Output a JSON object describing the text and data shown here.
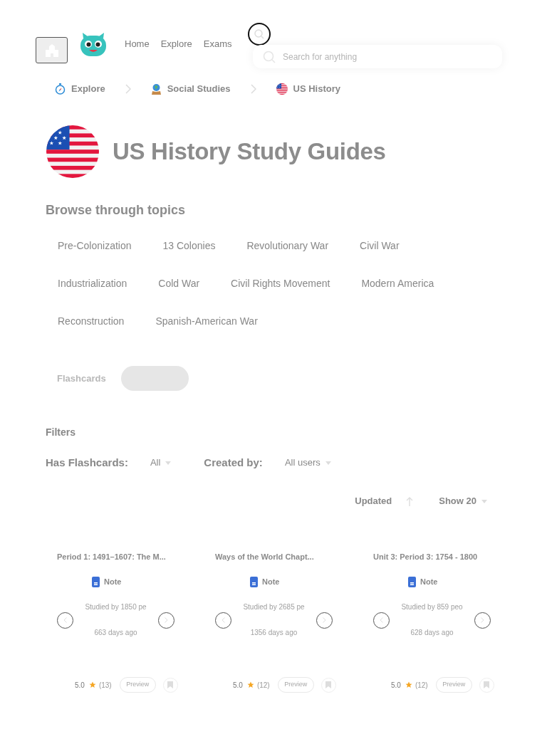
{
  "header": {
    "nav": [
      {
        "label": "Home"
      },
      {
        "label": "Explore"
      },
      {
        "label": "Exams"
      }
    ],
    "search": {
      "placeholder": "Search for anything"
    }
  },
  "breadcrumb": [
    {
      "label": "Explore",
      "kind": "compass"
    },
    {
      "label": "Social Studies",
      "kind": "globe"
    },
    {
      "label": "US History",
      "kind": "flag"
    }
  ],
  "page": {
    "title": "US History Study Guides"
  },
  "topics": {
    "heading": "Browse through topics",
    "items": [
      "Pre-Colonization",
      "13 Colonies",
      "Revolutionary War",
      "Civil War",
      "Industrialization",
      "Cold War",
      "Civil Rights Movement",
      "Modern America",
      "Reconstruction",
      "Spanish-American War"
    ]
  },
  "tabs": [
    {
      "label": "Flashcards",
      "selected": false
    },
    {
      "selected": true
    }
  ],
  "filters": {
    "heading": "Filters",
    "fields": [
      {
        "label": "Has Flashcards:",
        "value": "All"
      },
      {
        "label": "Created by:",
        "value": "All users"
      }
    ]
  },
  "sort": {
    "label": "Updated",
    "page_size": "Show 20"
  },
  "cards": [
    {
      "title": "Period 1: 1491–1607: The M...",
      "type": "Note",
      "studied": "Studied by 1850 pe",
      "age": "663 days ago",
      "rating": "5.0",
      "count": "(13)",
      "action": "Preview"
    },
    {
      "title": "Ways of the World Chapt...",
      "type": "Note",
      "studied": "Studied by 2685 pe",
      "age": "1356 days ago",
      "rating": "5.0",
      "count": "(12)",
      "action": "Preview"
    },
    {
      "title": "Unit 3: Period 3: 1754 - 1800",
      "type": "Note",
      "studied": "Studied by 859 peo",
      "age": "628 days ago",
      "rating": "5.0",
      "count": "(12)",
      "action": "Preview"
    }
  ]
}
